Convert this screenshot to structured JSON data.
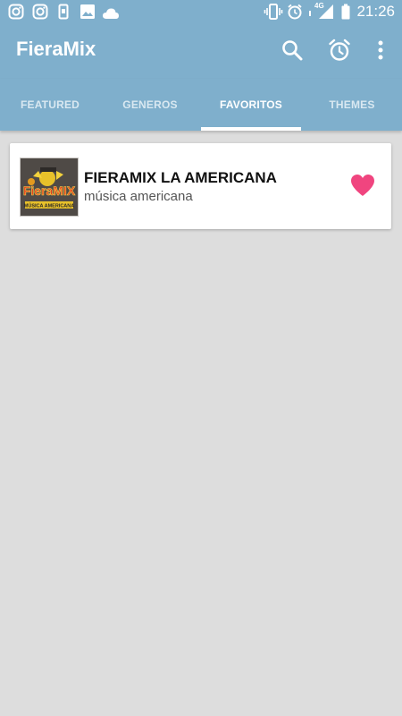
{
  "status_bar": {
    "time": "21:26",
    "network_label": "4G",
    "icons": [
      "instagram-icon",
      "instagram-icon",
      "phone-notification-icon",
      "image-icon",
      "cloud-icon",
      "vibrate-icon",
      "alarm-icon",
      "signal-icon",
      "battery-icon"
    ]
  },
  "app_bar": {
    "title": "FieraMix",
    "actions": [
      "search-icon",
      "alarm-icon",
      "more-vert-icon"
    ]
  },
  "tabs": [
    {
      "label": "FEATURED",
      "active": false
    },
    {
      "label": "GENEROS",
      "active": false
    },
    {
      "label": "FAVORITOS",
      "active": true
    },
    {
      "label": "THEMES",
      "active": false
    }
  ],
  "favorites": [
    {
      "title": "FIERAMIX LA AMERICANA",
      "subtitle": "música americana",
      "favorited": true,
      "logo_text": "FieraMIX",
      "logo_caption": "MÚSICA AMERICANA"
    }
  ],
  "colors": {
    "primary": "#7fafcc",
    "background": "#dddddd",
    "heart": "#f0457f",
    "card": "#ffffff"
  }
}
